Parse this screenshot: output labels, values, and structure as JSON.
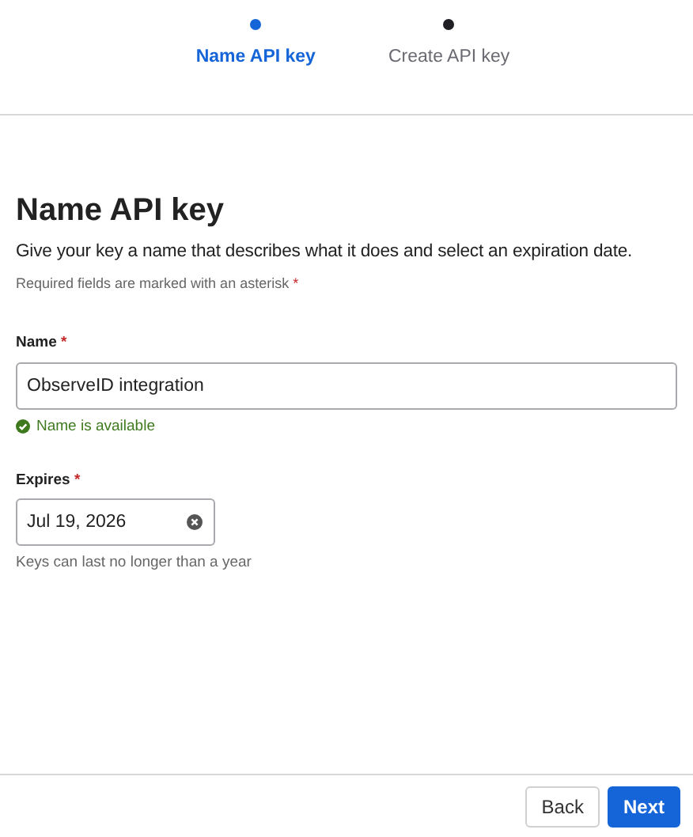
{
  "steps": [
    {
      "label": "Name API key",
      "selected": true
    },
    {
      "label": "Create API key",
      "selected": false
    }
  ],
  "title": "Name API key",
  "description": "Give your key a name that describes what it does and select an expiration date.",
  "required_note": {
    "text": "Required fields are marked with an asterisk",
    "mark": "*"
  },
  "fields": [
    {
      "kind": "text",
      "label": "Name",
      "mark": "*",
      "value": "ObserveID integration",
      "message": {
        "kind": "valid",
        "text": "Name is available"
      }
    },
    {
      "kind": "date",
      "label": "Expires",
      "mark": "*",
      "value": "Jul 19, 2026",
      "message": {
        "kind": "help",
        "text": "Keys can last no longer than a year"
      }
    }
  ],
  "buttons": [
    {
      "label": "Back",
      "kind": "secondary"
    },
    {
      "label": "Next",
      "kind": "primary"
    }
  ]
}
